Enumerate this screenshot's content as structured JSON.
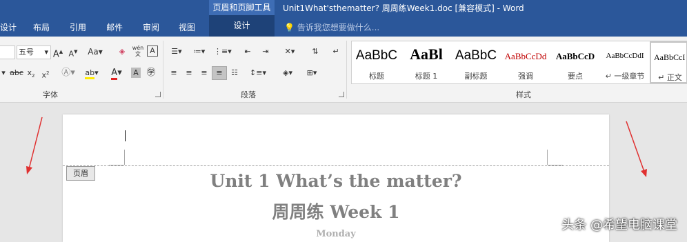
{
  "titlebar": {
    "context_group": "页眉和页脚工具",
    "doc_title": "Unit1What'sthematter? 周周练Week1.doc [兼容模式] - Word",
    "tabs": [
      "设计",
      "布局",
      "引用",
      "邮件",
      "审阅",
      "视图"
    ],
    "context_tab": "设计",
    "tell_me": "告诉我您想要做什么..."
  },
  "ribbon": {
    "font_size": "五号",
    "groups": {
      "font": "字体",
      "paragraph": "段落",
      "styles": "样式"
    },
    "styles": [
      {
        "sample": "AaBbC",
        "name": "标题"
      },
      {
        "sample": "AaBl",
        "name": "标题 1"
      },
      {
        "sample": "AaBbC",
        "name": "副标题"
      },
      {
        "sample": "AaBbCcDd",
        "name": "强调"
      },
      {
        "sample": "AaBbCcD",
        "name": "要点"
      },
      {
        "sample": "AaBbCcDdI",
        "name": "↵ 一级章节"
      },
      {
        "sample": "AaBbCcI",
        "name": "↵ 正文"
      }
    ]
  },
  "document": {
    "header_tag": "页眉",
    "line1": "Unit 1 What’s the matter?",
    "line2": "周周练 Week 1",
    "line3": "Monday"
  },
  "watermark": "头条 @希望电脑课堂",
  "colors": {
    "titlebar": "#2b579a",
    "arrow": "#e03030"
  }
}
